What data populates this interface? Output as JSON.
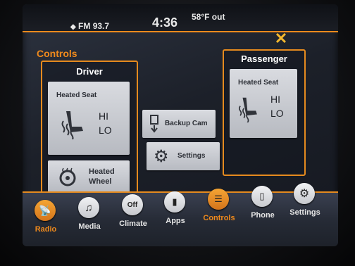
{
  "status": {
    "radio": "FM 93.7",
    "time": "4:36",
    "temperature": "58°F out"
  },
  "header": {
    "title": "Controls"
  },
  "driver": {
    "title": "Driver",
    "heated_seat_label": "Heated Seat",
    "heated_seat_hi": "HI",
    "heated_seat_lo": "LO",
    "heated_wheel_label_line1": "Heated",
    "heated_wheel_label_line2": "Wheel"
  },
  "center": {
    "backup_cam": "Backup Cam",
    "settings": "Settings"
  },
  "passenger": {
    "title": "Passenger",
    "heated_seat_label": "Heated Seat",
    "heated_seat_hi": "HI",
    "heated_seat_lo": "LO"
  },
  "nav": [
    {
      "label": "Radio",
      "icon": "radio-icon"
    },
    {
      "label": "Media",
      "icon": "music-icon"
    },
    {
      "label": "Climate",
      "icon": "off-icon",
      "icon_text": "Off"
    },
    {
      "label": "Apps",
      "icon": "apps-icon"
    },
    {
      "label": "Controls",
      "icon": "controls-icon",
      "active": true
    },
    {
      "label": "Phone",
      "icon": "phone-icon"
    },
    {
      "label": "Settings",
      "icon": "gear-icon"
    }
  ],
  "colors": {
    "accent": "#f08a1c",
    "tile": "#c9cbd0",
    "background": "#1c2029"
  }
}
